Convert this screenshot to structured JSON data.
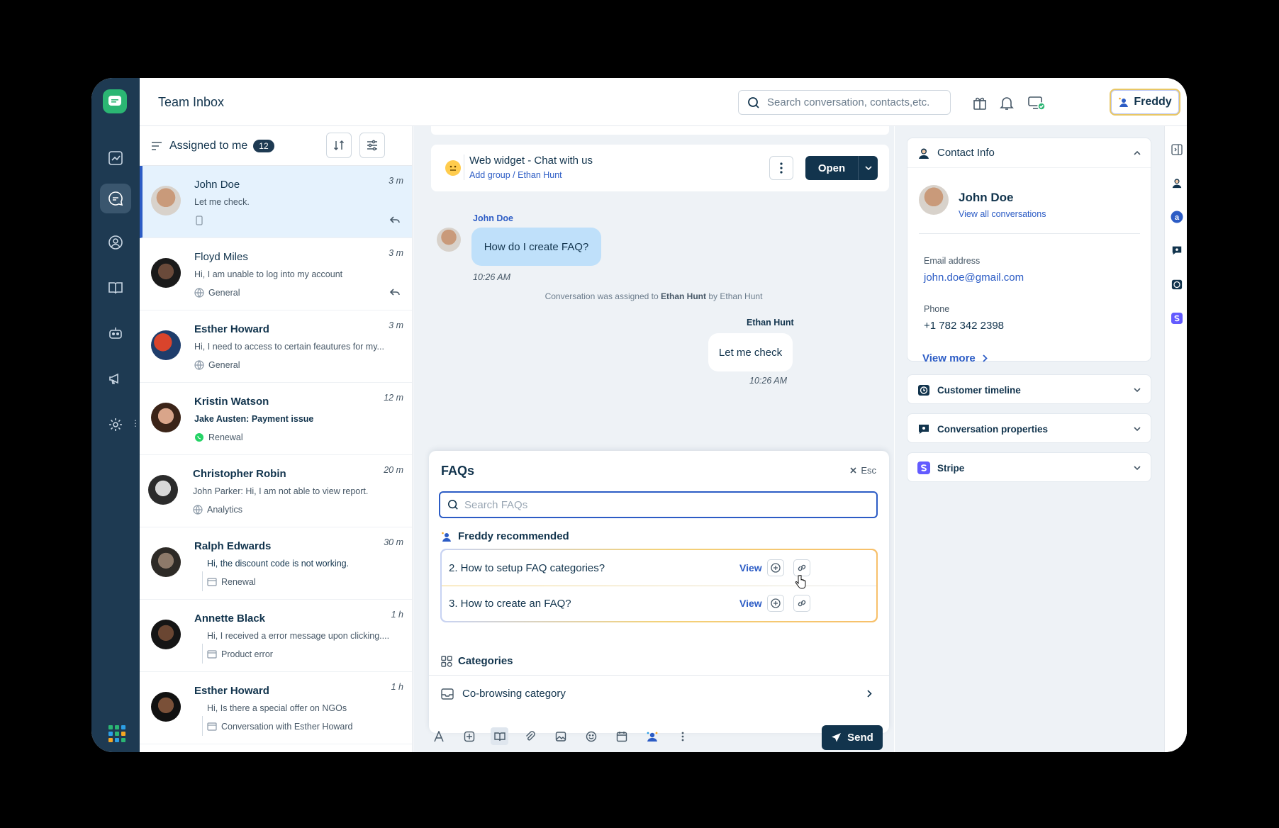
{
  "app": {
    "title": "Team Inbox"
  },
  "topbar": {
    "search_placeholder": "Search conversation, contacts,etc.",
    "freddy_label": "Freddy"
  },
  "list": {
    "header_label": "Assigned to me",
    "count": "12",
    "items": [
      {
        "name": "John Doe",
        "preview": "Let me check.",
        "tag": "",
        "time": "3 m",
        "bold": false
      },
      {
        "name": "Floyd Miles",
        "preview": "Hi, I am unable to log into my account",
        "tag": "General",
        "time": "3 m",
        "bold": false
      },
      {
        "name": "Esther Howard",
        "preview": "Hi, I need to access to certain feautures for my...",
        "tag": "General",
        "time": "3 m",
        "bold": true
      },
      {
        "name": "Kristin Watson",
        "preview": "Jake Austen: Payment issue",
        "tag": "Renewal",
        "time": "12 m",
        "bold": true
      },
      {
        "name": "Christopher Robin",
        "preview": "John Parker: Hi, I am not able to view report.",
        "tag": "Analytics",
        "time": "20 m",
        "bold": true
      },
      {
        "name": "Ralph Edwards",
        "preview": "Hi, the discount code is not working.",
        "tag": "Renewal",
        "time": "30 m",
        "bold": true
      },
      {
        "name": "Annette Black",
        "preview": "Hi, I received a error message upon clicking....",
        "tag": "Product error",
        "time": "1 h",
        "bold": true
      },
      {
        "name": "Esther Howard",
        "preview": "Hi, Is there a special offer on NGOs",
        "tag": "Conversation with Esther Howard",
        "time": "1 h",
        "bold": true
      }
    ]
  },
  "chat": {
    "title": "Web widget - Chat with us",
    "sub_add_group": "Add group",
    "sub_sep": " / ",
    "sub_agent": "Ethan Hunt",
    "open_label": "Open",
    "incoming": {
      "sender": "John Doe",
      "text": "How do I create FAQ?",
      "time": "10:26 AM"
    },
    "system": {
      "prefix": "Conversation was assigned to ",
      "assignee": "Ethan Hunt",
      "suffix": " by Ethan Hunt"
    },
    "outgoing": {
      "sender": "Ethan Hunt",
      "text": "Let me check",
      "time": "10:26 AM"
    },
    "send_label": "Send"
  },
  "faq": {
    "title": "FAQs",
    "esc_label": "Esc",
    "search_placeholder": "Search FAQs",
    "recommended_title": "Freddy recommended",
    "recommended": [
      {
        "text": "2. How to setup FAQ categories?",
        "view": "View"
      },
      {
        "text": "3. How to create an FAQ?",
        "view": "View"
      }
    ],
    "categories_title": "Categories",
    "categories": [
      {
        "label": "Co-browsing category"
      }
    ]
  },
  "contact": {
    "panel_title": "Contact Info",
    "name": "John Doe",
    "view_all": "View all conversations",
    "email_label": "Email address",
    "email": "john.doe@gmail.com",
    "phone_label": "Phone",
    "phone": "+1 782 342 2398",
    "view_more": "View more"
  },
  "accordions": [
    {
      "label": "Customer timeline"
    },
    {
      "label": "Conversation properties"
    },
    {
      "label": "Stripe"
    }
  ],
  "colors": {
    "primary": "#12344d",
    "accent": "#2c5cc5",
    "rail": "#1e3a52",
    "brand_green": "#2bb673"
  }
}
